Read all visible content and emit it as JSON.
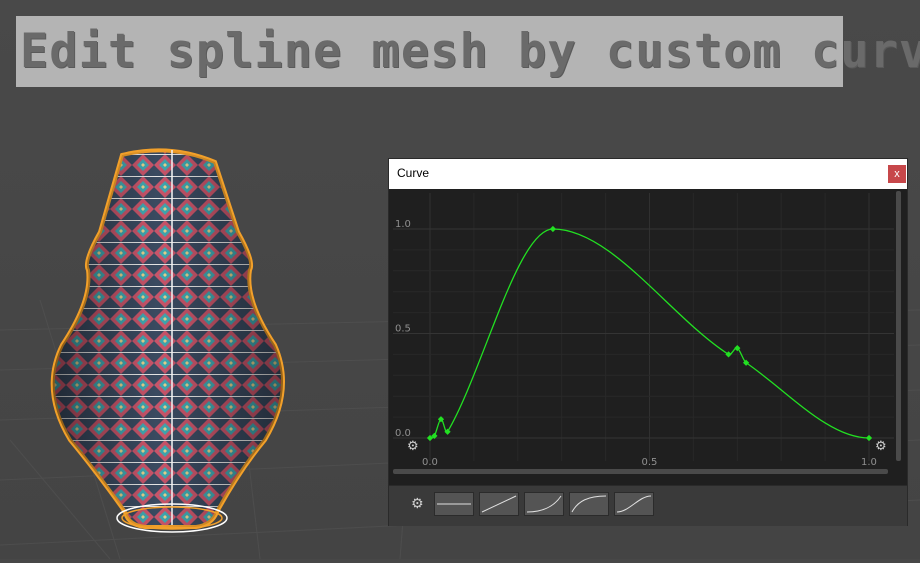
{
  "banner": {
    "text": "Edit spline mesh by custom curve"
  },
  "curve_window": {
    "title": "Curve",
    "close_label": "x",
    "y_tick_labels": [
      "1.0",
      "0.5",
      "0.0"
    ],
    "x_tick_labels": [
      "0.0",
      "0.5",
      "1.0"
    ],
    "curve_color": "#22e022",
    "keys": [
      {
        "t": 0.0,
        "v": 0.0
      },
      {
        "t": 0.01,
        "v": 0.01
      },
      {
        "t": 0.025,
        "v": 0.09
      },
      {
        "t": 0.04,
        "v": 0.03
      },
      {
        "t": 0.28,
        "v": 1.0
      },
      {
        "t": 0.68,
        "v": 0.4
      },
      {
        "t": 0.7,
        "v": 0.43
      },
      {
        "t": 0.72,
        "v": 0.36
      },
      {
        "t": 1.0,
        "v": 0.0
      }
    ],
    "presets": [
      "flat",
      "linear",
      "ease-in",
      "ease-out",
      "ease-in-out"
    ]
  }
}
